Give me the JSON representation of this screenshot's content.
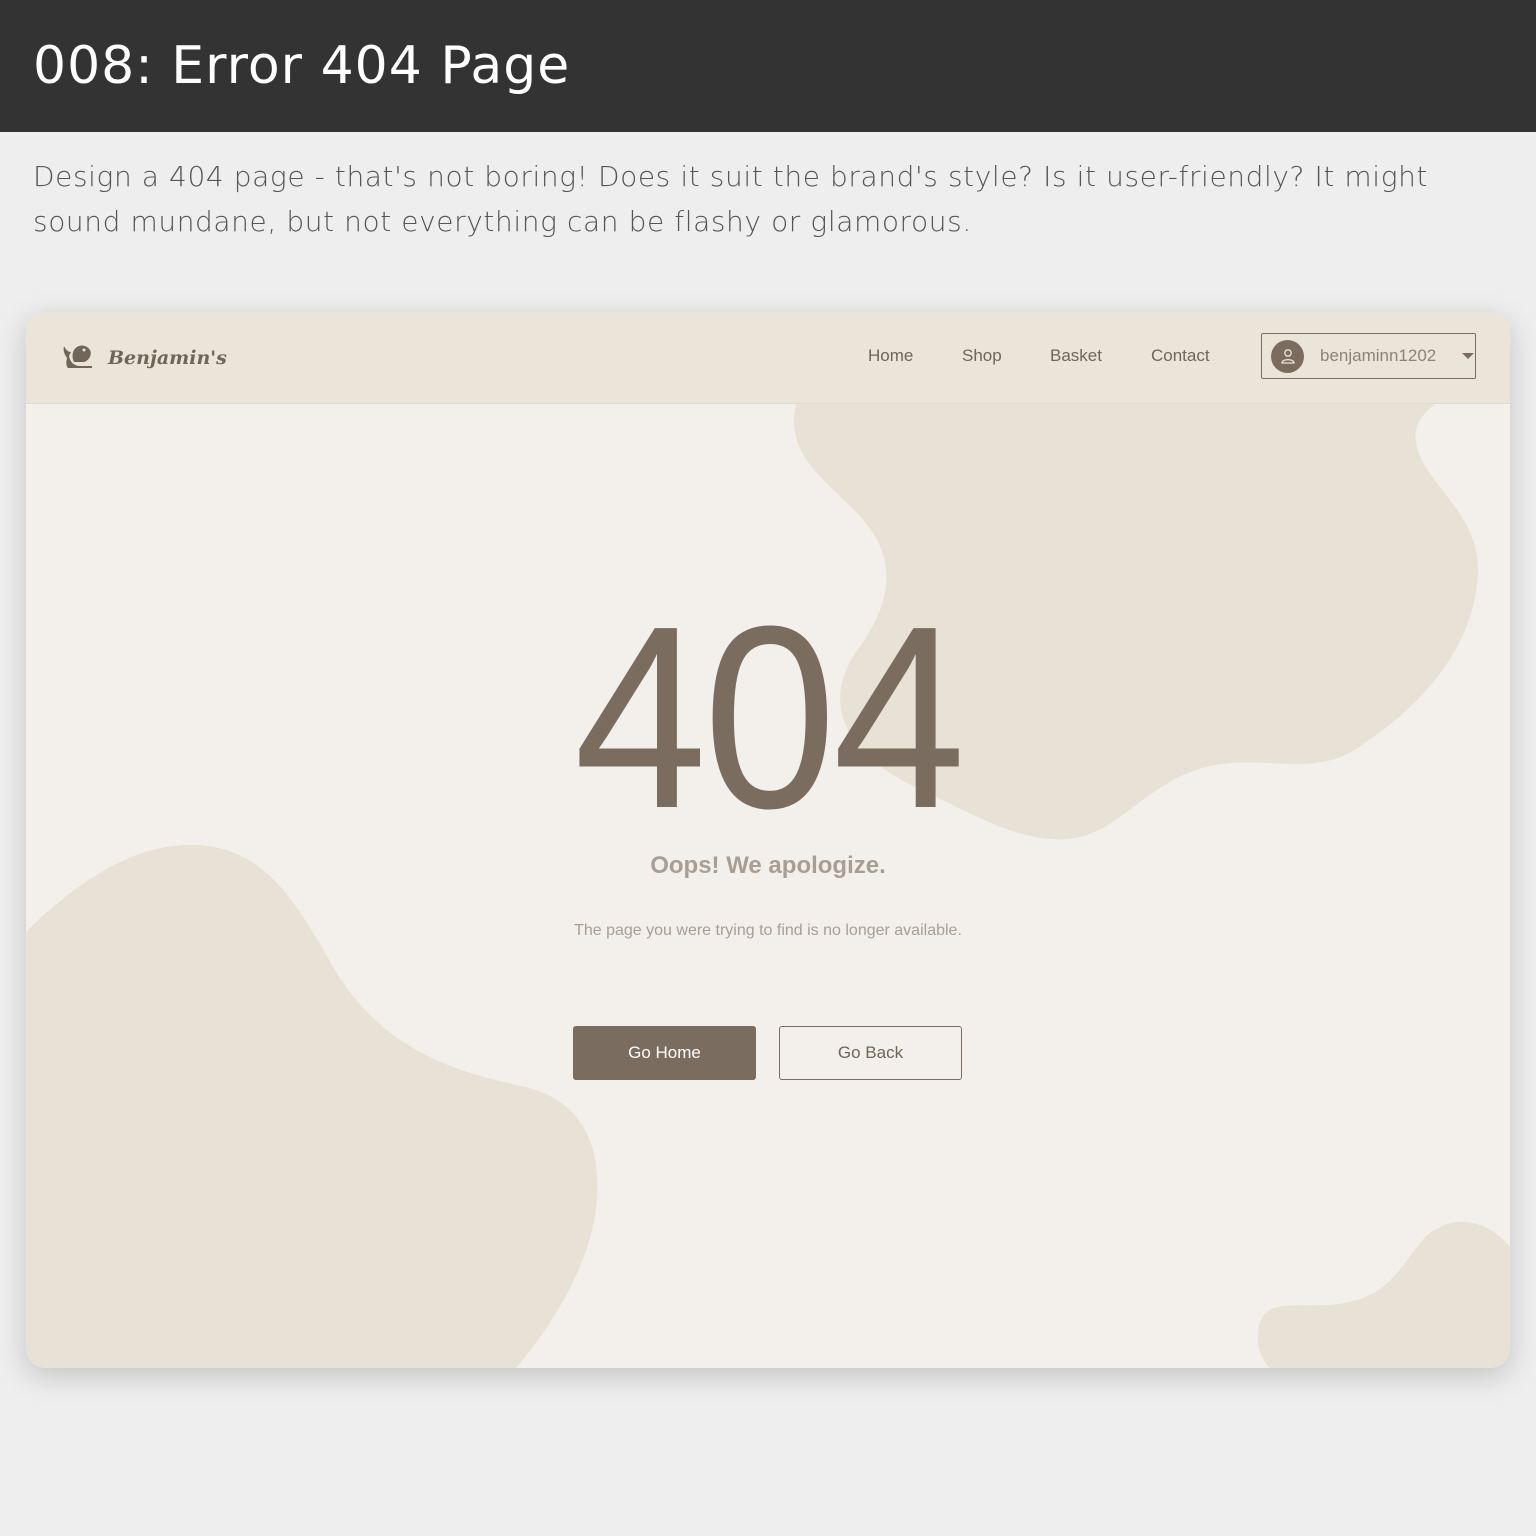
{
  "header": {
    "title": "008: Error 404 Page"
  },
  "description": "Design a 404 page - that's not boring! Does it suit the brand's style? Is it user-friendly? It might sound mundane, but not everything can be flashy or glamorous.",
  "mockup": {
    "brand": {
      "name": "Benjamin's",
      "logo_icon": "bird-icon"
    },
    "nav": {
      "items": [
        {
          "label": "Home"
        },
        {
          "label": "Shop"
        },
        {
          "label": "Basket"
        },
        {
          "label": "Contact"
        }
      ]
    },
    "user": {
      "username": "benjaminn1202",
      "avatar_icon": "user-icon",
      "dropdown_icon": "caret-down-icon"
    },
    "error": {
      "code": "404",
      "heading": "Oops! We apologize.",
      "message": "The page you were trying to find is no longer available."
    },
    "buttons": {
      "home_label": "Go Home",
      "back_label": "Go Back"
    },
    "colors": {
      "primary": "#7a6d5f",
      "navbar_bg": "#ebe4d8",
      "page_bg": "#f3efea",
      "blob": "#e8e0d4",
      "muted_text": "#a89e94"
    }
  }
}
